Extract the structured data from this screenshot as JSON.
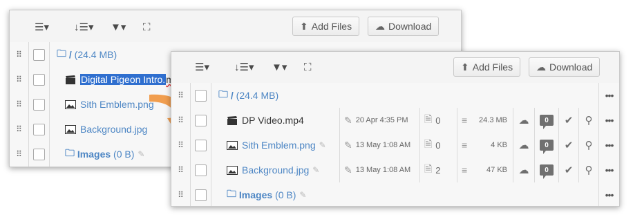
{
  "toolbar": {
    "view_icon": "list-view-icon",
    "sort_icon": "sort-icon",
    "filter_icon": "filter-icon",
    "fullscreen_icon": "fullscreen-icon",
    "add_files_label": "Add Files",
    "download_label": "Download"
  },
  "back_panel": {
    "folder_row": {
      "name": "/",
      "size": "(24.4 MB)"
    },
    "rows": [
      {
        "name_selected": "Digital Pigeon Intro.",
        "name_rest": "m",
        "type": "video"
      },
      {
        "name": "Sith Emblem.png",
        "type": "image"
      },
      {
        "name": "Background.jpg",
        "type": "image"
      }
    ],
    "subfolder": {
      "name": "Images",
      "size": "(0 B)"
    }
  },
  "front_panel": {
    "folder_row": {
      "name": "/",
      "size": "(24.4 MB)"
    },
    "rows": [
      {
        "name": "DP Video.mp4",
        "type": "video",
        "date": "20 Apr 4:35 PM",
        "downloads": "0",
        "size": "24.3 MB",
        "comments": "0"
      },
      {
        "name": "Sith Emblem.png",
        "type": "image",
        "date": "13 May 1:08 AM",
        "downloads": "0",
        "size": "4 KB",
        "comments": "0"
      },
      {
        "name": "Background.jpg",
        "type": "image",
        "date": "13 May 1:08 AM",
        "downloads": "2",
        "size": "47 KB",
        "comments": "0"
      }
    ],
    "subfolder": {
      "name": "Images",
      "size": "(0 B)"
    }
  },
  "colors": {
    "accent": "#4d86c4",
    "arrow": "#f0943c",
    "selection": "#2f6fcf"
  }
}
